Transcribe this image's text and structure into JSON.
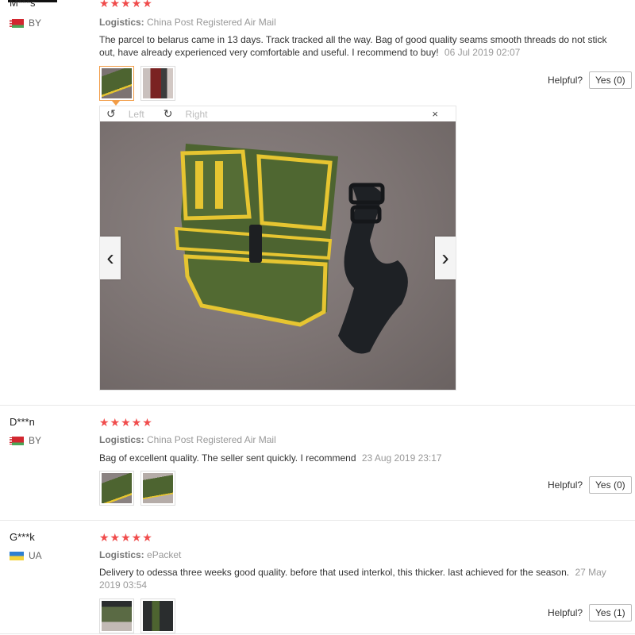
{
  "reviews": [
    {
      "user": "M***s",
      "country": "BY",
      "stars": "★★★★★",
      "logistics_label": "Logistics:",
      "logistics_value": "China Post Registered Air Mail",
      "text": "The parcel to belarus came in 13 days. Track tracked all the way. Bag of good quality seams smooth threads do not stick out, have already experienced very comfortable and useful. I recommend to buy!",
      "date": "06 Jul 2019 02:07",
      "helpful_label": "Helpful?",
      "yes_label": "Yes (0)"
    },
    {
      "user": "D***n",
      "country": "BY",
      "stars": "★★★★★",
      "logistics_label": "Logistics:",
      "logistics_value": "China Post Registered Air Mail",
      "text": "Bag of excellent quality. The seller sent quickly. I recommend",
      "date": "23 Aug 2019 23:17",
      "helpful_label": "Helpful?",
      "yes_label": "Yes (0)"
    },
    {
      "user": "G***k",
      "country": "UA",
      "stars": "★★★★★",
      "logistics_label": "Logistics:",
      "logistics_value": "ePacket",
      "text": "Delivery to odessa three weeks good quality. before that used interkol, this thicker. last achieved for the season.",
      "date": "27 May 2019 03:54",
      "helpful_label": "Helpful?",
      "yes_label": "Yes (1)"
    }
  ],
  "viewer": {
    "rotate_left": "Left",
    "rotate_right": "Right",
    "close": "×",
    "prev": "‹",
    "next": "›"
  },
  "colors": {
    "stars": "#f04c4c",
    "active_thumb": "#f29c46",
    "bag_green": "#4d6430",
    "trim_yellow": "#e6c531"
  }
}
